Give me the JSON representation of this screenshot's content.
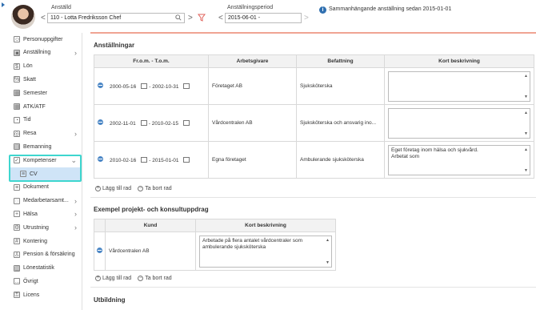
{
  "header": {
    "employee_label": "Anställd",
    "employee_value": "110 - Lotta Fredriksson Chef",
    "period_label": "Anställningsperiod",
    "period_value": "2015-06-01 -",
    "info_text": "Sammanhängande anställning sedan 2015-01-01",
    "prev_glyph": "<",
    "next_glyph": ">"
  },
  "sidebar": {
    "items": [
      {
        "label": "Personuppgifter",
        "icon": "person-icon",
        "chev": ""
      },
      {
        "label": "Anställning",
        "icon": "briefcase-icon",
        "chev": "›"
      },
      {
        "label": "Lön",
        "icon": "money-icon",
        "chev": ""
      },
      {
        "label": "Skatt",
        "icon": "tax-icon",
        "chev": ""
      },
      {
        "label": "Semester",
        "icon": "calendar-icon",
        "chev": ""
      },
      {
        "label": "ATK/ATF",
        "icon": "calendar-icon",
        "chev": ""
      },
      {
        "label": "Tid",
        "icon": "clock-icon",
        "chev": ""
      },
      {
        "label": "Resa",
        "icon": "globe-icon",
        "chev": "›"
      },
      {
        "label": "Bemanning",
        "icon": "staffing-icon",
        "chev": ""
      },
      {
        "label": "Kompetenser",
        "icon": "competence-icon",
        "chev": "⌄"
      },
      {
        "label": "CV",
        "icon": "document-icon",
        "chev": ""
      },
      {
        "label": "Dokument",
        "icon": "document-icon",
        "chev": ""
      },
      {
        "label": "Medarbetarsamt...",
        "icon": "chat-icon",
        "chev": "›"
      },
      {
        "label": "Hälsa",
        "icon": "health-icon",
        "chev": "›"
      },
      {
        "label": "Utrustning",
        "icon": "equipment-icon",
        "chev": "›"
      },
      {
        "label": "Kontering",
        "icon": "accounting-icon",
        "chev": ""
      },
      {
        "label": "Pension & försäkring",
        "icon": "pension-icon",
        "chev": ""
      },
      {
        "label": "Lönestatistik",
        "icon": "stats-icon",
        "chev": ""
      },
      {
        "label": "Övrigt",
        "icon": "misc-icon",
        "chev": ""
      },
      {
        "label": "Licens",
        "icon": "key-icon",
        "chev": ""
      }
    ]
  },
  "employment": {
    "title": "Anställningar",
    "columns": [
      "Fr.o.m. - T.o.m.",
      "Arbetsgivare",
      "Befattning",
      "Kort beskrivning"
    ],
    "rows": [
      {
        "from": "2000-05-16",
        "to": "2002-10-31",
        "employer": "Företaget AB",
        "position": "Sjuksköterska",
        "description": ""
      },
      {
        "from": "2002-11-01",
        "to": "2010-02-15",
        "employer": "Vårdcentralen AB",
        "position": "Sjuksköterska och ansvarig ino...",
        "description": ""
      },
      {
        "from": "2010-02-16",
        "to": "2015-01-01",
        "employer": "Egna företaget",
        "position": "Ambulerande sjuksköterska",
        "description": "Eget företag inom hälsa och sjukvård.\nArbetat som"
      }
    ],
    "add_row": "Lägg till rad",
    "remove_row": "Ta bort rad"
  },
  "projects": {
    "title": "Exempel projekt- och konsultuppdrag",
    "columns": [
      "Kund",
      "Kort beskrivning"
    ],
    "rows": [
      {
        "customer": "Vårdcentralen AB",
        "description": "Arbetade på flera antalet vårdcentraler som\nambulerande sjuksköterska"
      }
    ],
    "add_row": "Lägg till rad",
    "remove_row": "Ta bort rad"
  },
  "education": {
    "title": "Utbildning"
  },
  "colors": {
    "accent": "#2f6fb0",
    "highlight": "#3ed6cf",
    "divider": "#f0a493",
    "active_item": "#cfe4f7"
  }
}
